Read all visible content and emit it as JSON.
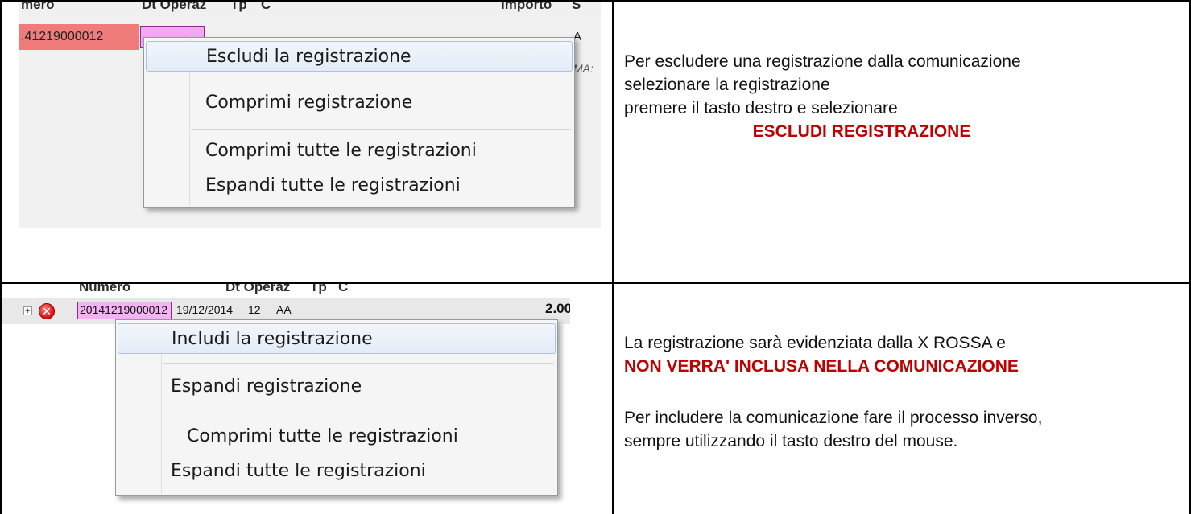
{
  "panel1": {
    "screenshot": {
      "header": {
        "numero": "mero",
        "dt_operaz": "Dt Operaz",
        "tp": "Tp",
        "c": "C",
        "importo": "Importo",
        "s": "S"
      },
      "row": {
        "numero": ".41219000012",
        "importo_partial": "A",
        "italic_partial": "MA:"
      },
      "menu": [
        "Escludi la registrazione",
        "Comprimi registrazione",
        "Comprimi tutte le registrazioni",
        "Espandi tutte le registrazioni"
      ]
    },
    "text": {
      "line1": "Per escludere una registrazione dalla comunicazione",
      "line2": "selezionare la registrazione",
      "line3": "premere il tasto destro e selezionare",
      "highlight": "ESCLUDI REGISTRAZIONE"
    }
  },
  "panel2": {
    "screenshot": {
      "header": {
        "numero": "Numero",
        "dt_operaz": "Dt Operaz",
        "tp": "Tp",
        "c": "C"
      },
      "row": {
        "numero": "20141219000012",
        "dt_operaz": "19/12/2014",
        "tp": "12",
        "c": "AA",
        "importo": "2.00"
      },
      "menu": [
        "Includi la registrazione",
        "Espandi registrazione",
        "Comprimi tutte le registrazioni",
        "Espandi tutte le registrazioni"
      ]
    },
    "text": {
      "line1": "La registrazione sarà evidenziata dalla X ROSSA e",
      "highlight": "NON VERRA' INCLUSA NELLA COMUNICAZIONE",
      "line3": "Per includere la comunicazione fare il processo inverso,",
      "line4": "sempre utilizzando il tasto destro del mouse."
    }
  },
  "colors": {
    "accent_red": "#c00000",
    "row_red": "#ef7b7b",
    "cell_pink": "#f2a8f2",
    "x_icon": "#d01010"
  },
  "icons": {
    "expander": "plus-expander-icon",
    "excluded": "red-x-circle-icon"
  }
}
